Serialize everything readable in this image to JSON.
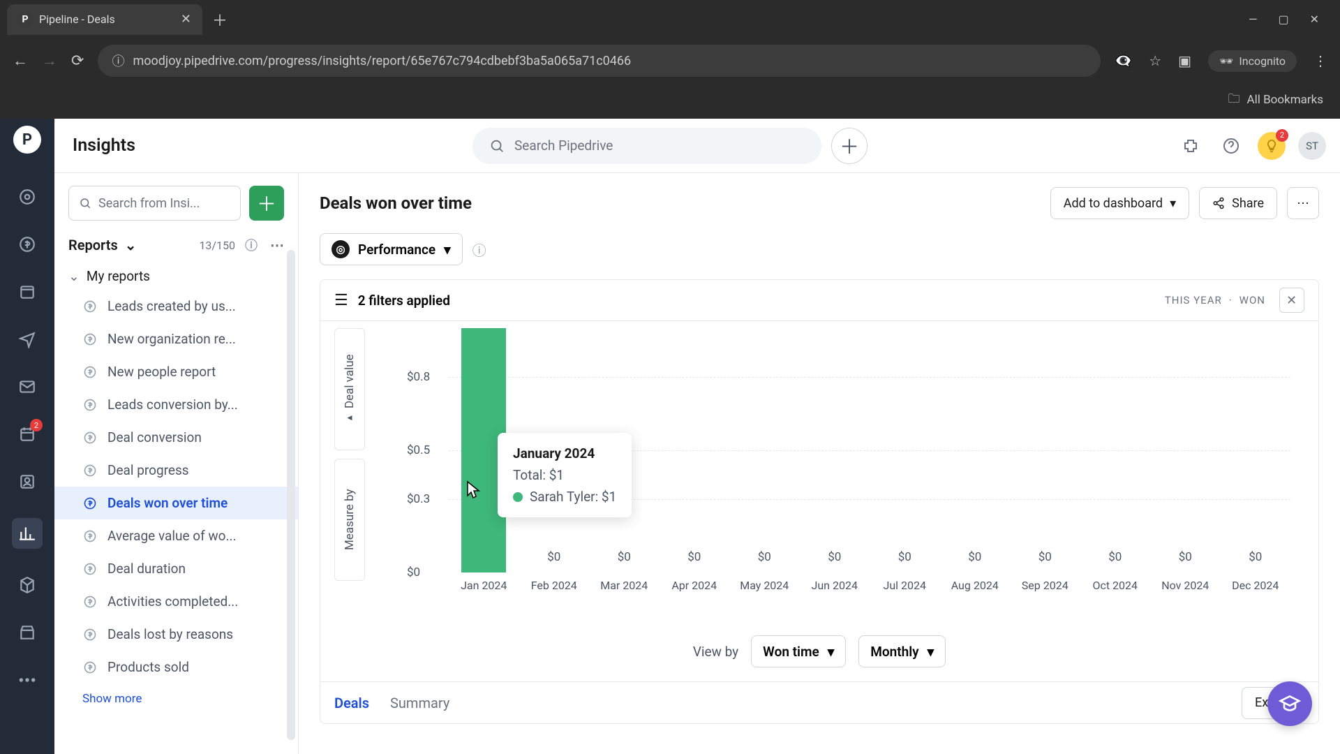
{
  "browser": {
    "tab_title": "Pipeline - Deals",
    "tab_favicon_letter": "P",
    "url": "moodjoy.pipedrive.com/progress/insights/report/65e767c794cdbebf3ba5a065a71c0466",
    "incognito_label": "Incognito",
    "all_bookmarks": "All Bookmarks"
  },
  "topbar": {
    "title": "Insights",
    "search_placeholder": "Search Pipedrive",
    "avatar_initials": "ST",
    "hint_badge": "2"
  },
  "rail": {
    "projects_badge": "2"
  },
  "sidebar": {
    "search_placeholder": "Search from Insi...",
    "section_label": "Reports",
    "section_count": "13/150",
    "group_label": "My reports",
    "items": [
      "Leads created by us...",
      "New organization re...",
      "New people report",
      "Leads conversion by...",
      "Deal conversion",
      "Deal progress",
      "Deals won over time",
      "Average value of wo...",
      "Deal duration",
      "Activities completed...",
      "Deals lost by reasons",
      "Products sold"
    ],
    "active_index": 6,
    "show_more": "Show more"
  },
  "page": {
    "title": "Deals won over time",
    "add_dashboard": "Add to dashboard",
    "share": "Share",
    "performance_label": "Performance",
    "filters_label": "2 filters applied",
    "filter_tag_1": "THIS YEAR",
    "filter_tag_2": "WON",
    "axis_1": "Deal value",
    "axis_2": "Measure by",
    "view_by_label": "View by",
    "dd1": "Won time",
    "dd2": "Monthly",
    "tab_deals": "Deals",
    "tab_summary": "Summary",
    "export": "Export"
  },
  "tooltip": {
    "title": "January 2024",
    "total": "Total: $1",
    "person": "Sarah Tyler: $1"
  },
  "chart_data": {
    "type": "bar",
    "title": "Deals won over time",
    "ylabel": "Deal value",
    "xlabel": "",
    "ylim": [
      0,
      1
    ],
    "y_ticks": [
      "$0",
      "$0.3",
      "$0.5",
      "$0.8"
    ],
    "categories": [
      "Jan 2024",
      "Feb 2024",
      "Mar 2024",
      "Apr 2024",
      "May 2024",
      "Jun 2024",
      "Jul 2024",
      "Aug 2024",
      "Sep 2024",
      "Oct 2024",
      "Nov 2024",
      "Dec 2024"
    ],
    "series": [
      {
        "name": "Sarah Tyler",
        "values": [
          1,
          0,
          0,
          0,
          0,
          0,
          0,
          0,
          0,
          0,
          0,
          0
        ]
      }
    ],
    "bar_labels": [
      "",
      "$0",
      "$0",
      "$0",
      "$0",
      "$0",
      "$0",
      "$0",
      "$0",
      "$0",
      "$0",
      "$0"
    ]
  }
}
